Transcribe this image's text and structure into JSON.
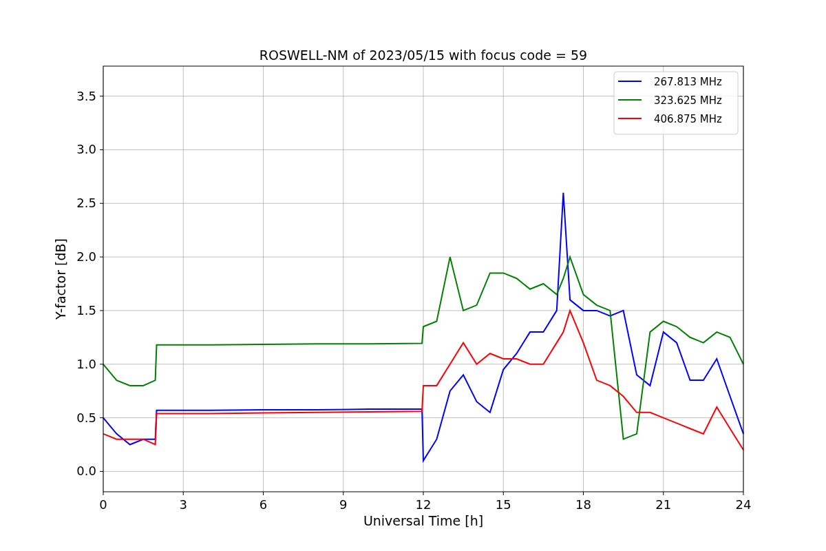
{
  "figure": {
    "chart_data": {
      "type": "line",
      "title": "ROSWELL-NM of 2023/05/15 with focus code = 59",
      "xlabel": "Universal Time [h]",
      "ylabel": "Y-factor [dB]",
      "x": [
        0,
        0.5,
        1,
        1.5,
        1.95,
        2,
        4,
        6,
        8,
        10,
        11.95,
        12,
        12.5,
        13,
        13.5,
        14,
        14.5,
        15,
        15.5,
        16,
        16.5,
        17,
        17.25,
        17.5,
        18,
        18.5,
        19,
        19.5,
        20,
        20.5,
        21,
        21.5,
        22,
        22.5,
        23,
        23.5,
        24
      ],
      "series": [
        {
          "name": "267.813 MHz",
          "color": "#0000ff",
          "values": [
            0.5,
            0.35,
            0.25,
            0.3,
            0.3,
            0.57,
            0.57,
            0.575,
            0.575,
            0.58,
            0.58,
            0.1,
            0.3,
            0.75,
            0.9,
            0.65,
            0.55,
            0.95,
            1.1,
            1.3,
            1.3,
            1.5,
            2.6,
            1.6,
            1.5,
            1.5,
            1.45,
            1.5,
            0.9,
            0.8,
            1.3,
            1.2,
            0.85,
            0.85,
            1.05,
            0.7,
            0.35
          ]
        },
        {
          "name": "323.625 MHz",
          "color": "#008000",
          "values": [
            1.0,
            0.85,
            0.8,
            0.8,
            0.85,
            1.18,
            1.18,
            1.185,
            1.19,
            1.19,
            1.195,
            1.35,
            1.4,
            2.0,
            1.5,
            1.55,
            1.85,
            1.85,
            1.8,
            1.7,
            1.75,
            1.65,
            1.8,
            2.0,
            1.65,
            1.55,
            1.5,
            0.3,
            0.35,
            1.3,
            1.4,
            1.35,
            1.25,
            1.2,
            1.3,
            1.25,
            1.0
          ]
        },
        {
          "name": "406.875 MHz",
          "color": "#ff0000",
          "values": [
            0.35,
            0.3,
            0.3,
            0.3,
            0.25,
            0.54,
            0.54,
            0.545,
            0.55,
            0.555,
            0.56,
            0.8,
            0.8,
            1.0,
            1.2,
            1.0,
            1.1,
            1.05,
            1.05,
            1.0,
            1.0,
            1.2,
            1.3,
            1.5,
            1.2,
            0.85,
            0.8,
            0.7,
            0.55,
            0.55,
            0.5,
            0.45,
            0.4,
            0.35,
            0.6,
            0.4,
            0.2
          ]
        }
      ],
      "grid": true,
      "legend": true,
      "xlim": [
        0,
        24
      ],
      "ylim": [
        -0.19,
        3.78
      ],
      "xticks": [
        0,
        3,
        6,
        9,
        12,
        15,
        18,
        21,
        24
      ],
      "yticks": [
        {
          "value": 0,
          "label": "0.0"
        },
        {
          "value": 0.5,
          "label": "0.5"
        },
        {
          "value": 1,
          "label": "1.0"
        },
        {
          "value": 1.5,
          "label": "1.5"
        },
        {
          "value": 2,
          "label": "2.0"
        },
        {
          "value": 2.5,
          "label": "2.5"
        },
        {
          "value": 3,
          "label": "3.0"
        },
        {
          "value": 3.5,
          "label": "3.5"
        }
      ]
    }
  }
}
